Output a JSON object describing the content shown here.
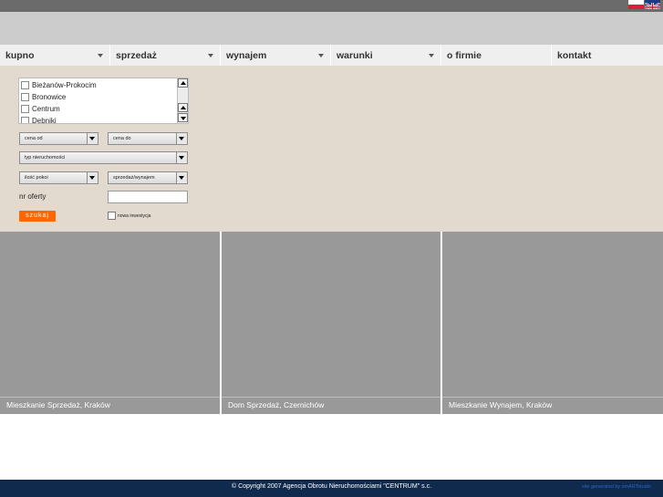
{
  "nav": {
    "items": [
      {
        "label": "kupno"
      },
      {
        "label": "sprzedaż"
      },
      {
        "label": "wynajem"
      },
      {
        "label": "warunki"
      },
      {
        "label": "o firmie"
      },
      {
        "label": "kontakt"
      }
    ]
  },
  "languages": {
    "icons": [
      "flag-pl-icon",
      "flag-en-icon"
    ]
  },
  "search": {
    "districts": [
      "Bieżanów-Prokocim",
      "Bronowice",
      "Centrum",
      "Dębniki"
    ],
    "price_from": "cena od",
    "price_to": "cena do",
    "property_type": "typ nieruchomości",
    "rooms": "ilość pokoi",
    "transaction": "sprzedaż/wynajem",
    "offer_number_label": "nr oferty",
    "offer_number_value": "",
    "search_button": "szukaj",
    "new_investment_label": "nowa inwestycja"
  },
  "tiles": [
    {
      "caption": "Mieszkanie Sprzedaż, Kraków"
    },
    {
      "caption": "Dom Sprzedaż, Czernichów"
    },
    {
      "caption": "Mieszkanie Wynajem, Kraków"
    }
  ],
  "footer": {
    "copyright": "© Copyright 2007 Agencja Obrotu Nieruchomościami \"CENTRUM\" s.c.",
    "credit": "site generated by smARTstudio"
  },
  "colors": {
    "nav_background": "#efefef",
    "search_panel": "#e2dace",
    "search_button": "#ff6600",
    "footer": "#0f2a4c",
    "tile_placeholder": "#999999"
  }
}
